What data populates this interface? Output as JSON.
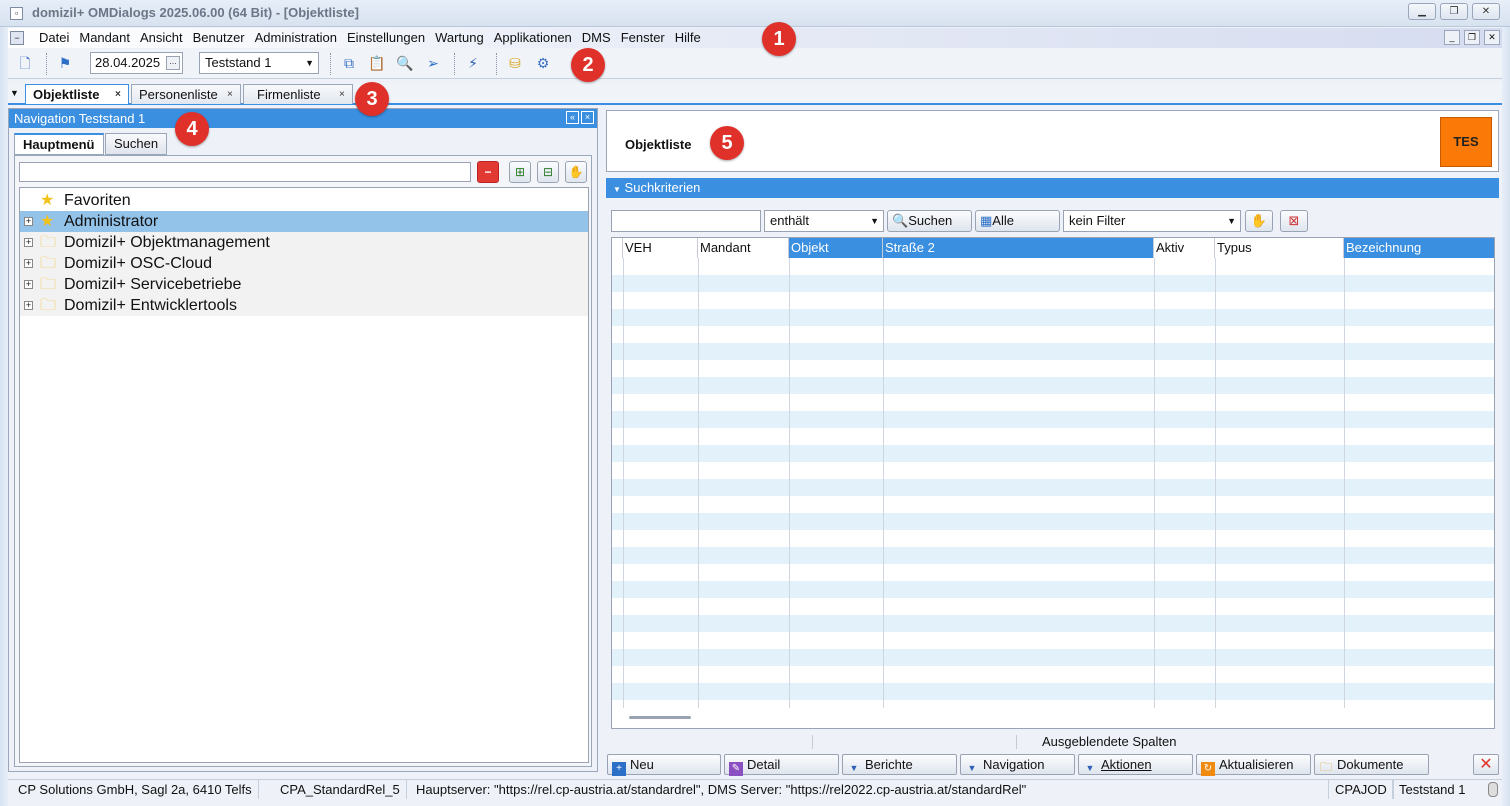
{
  "window": {
    "title": "domizil+ OMDialogs 2025.06.00 (64 Bit) - [Objektliste]"
  },
  "menu": {
    "items": [
      "Datei",
      "Mandant",
      "Ansicht",
      "Benutzer",
      "Administration",
      "Einstellungen",
      "Wartung",
      "Applikationen",
      "DMS",
      "Fenster",
      "Hilfe"
    ]
  },
  "toolbar": {
    "date": "28.04.2025",
    "environment": "Teststand 1"
  },
  "doc_tabs": [
    "Objektliste",
    "Personenliste",
    "Firmenliste"
  ],
  "navigation": {
    "title": "Navigation Teststand 1",
    "tabs": [
      "Hauptmenü",
      "Suchen"
    ],
    "tree": [
      {
        "label": "Favoriten",
        "icon": "star-icon",
        "expandable": false
      },
      {
        "label": "Administrator",
        "icon": "star-icon",
        "expandable": true,
        "selected": true
      },
      {
        "label": "Domizil+ Objektmanagement",
        "icon": "folder-icon",
        "expandable": true
      },
      {
        "label": "Domizil+ OSC-Cloud",
        "icon": "folder-icon",
        "expandable": true
      },
      {
        "label": "Domizil+ Servicebetriebe",
        "icon": "folder-icon",
        "expandable": true
      },
      {
        "label": "Domizil+ Entwicklertools",
        "icon": "folder-icon",
        "expandable": true
      }
    ]
  },
  "main": {
    "title": "Objektliste",
    "env_badge": "TES",
    "section": "Suchkriterien",
    "filter": {
      "search_value": "",
      "operator": "enthält",
      "search_button": "Suchen",
      "all_button": "Alle",
      "filter_select": "kein Filter"
    },
    "columns": [
      {
        "label": "VEH",
        "highlighted": false
      },
      {
        "label": "Mandant",
        "highlighted": false
      },
      {
        "label": "Objekt",
        "highlighted": true
      },
      {
        "label": "Straße 2",
        "highlighted": true
      },
      {
        "label": "Aktiv",
        "highlighted": false
      },
      {
        "label": "Typus",
        "highlighted": false
      },
      {
        "label": "Bezeichnung",
        "highlighted": true
      }
    ],
    "hidden_columns": "Ausgeblendete Spalten",
    "actions": [
      "Neu",
      "Detail",
      "Berichte",
      "Navigation",
      "Aktionen",
      "Aktualisieren",
      "Dokumente"
    ]
  },
  "status": {
    "company": "CP Solutions GmbH, Sagl 2a, 6410 Telfs",
    "release": "CPA_StandardRel_5",
    "servers": "Hauptserver: \"https://rel.cp-austria.at/standardrel\", DMS Server: \"https://rel2022.cp-austria.at/standardRel\"",
    "user": "CPAJOD",
    "env": "Teststand 1"
  },
  "badges": [
    "1",
    "2",
    "3",
    "4",
    "5"
  ],
  "colors": {
    "accent": "#3b8fe0",
    "badge": "#e0302a",
    "env_badge": "#fb7a07",
    "selected_row": "#94c3ea"
  }
}
